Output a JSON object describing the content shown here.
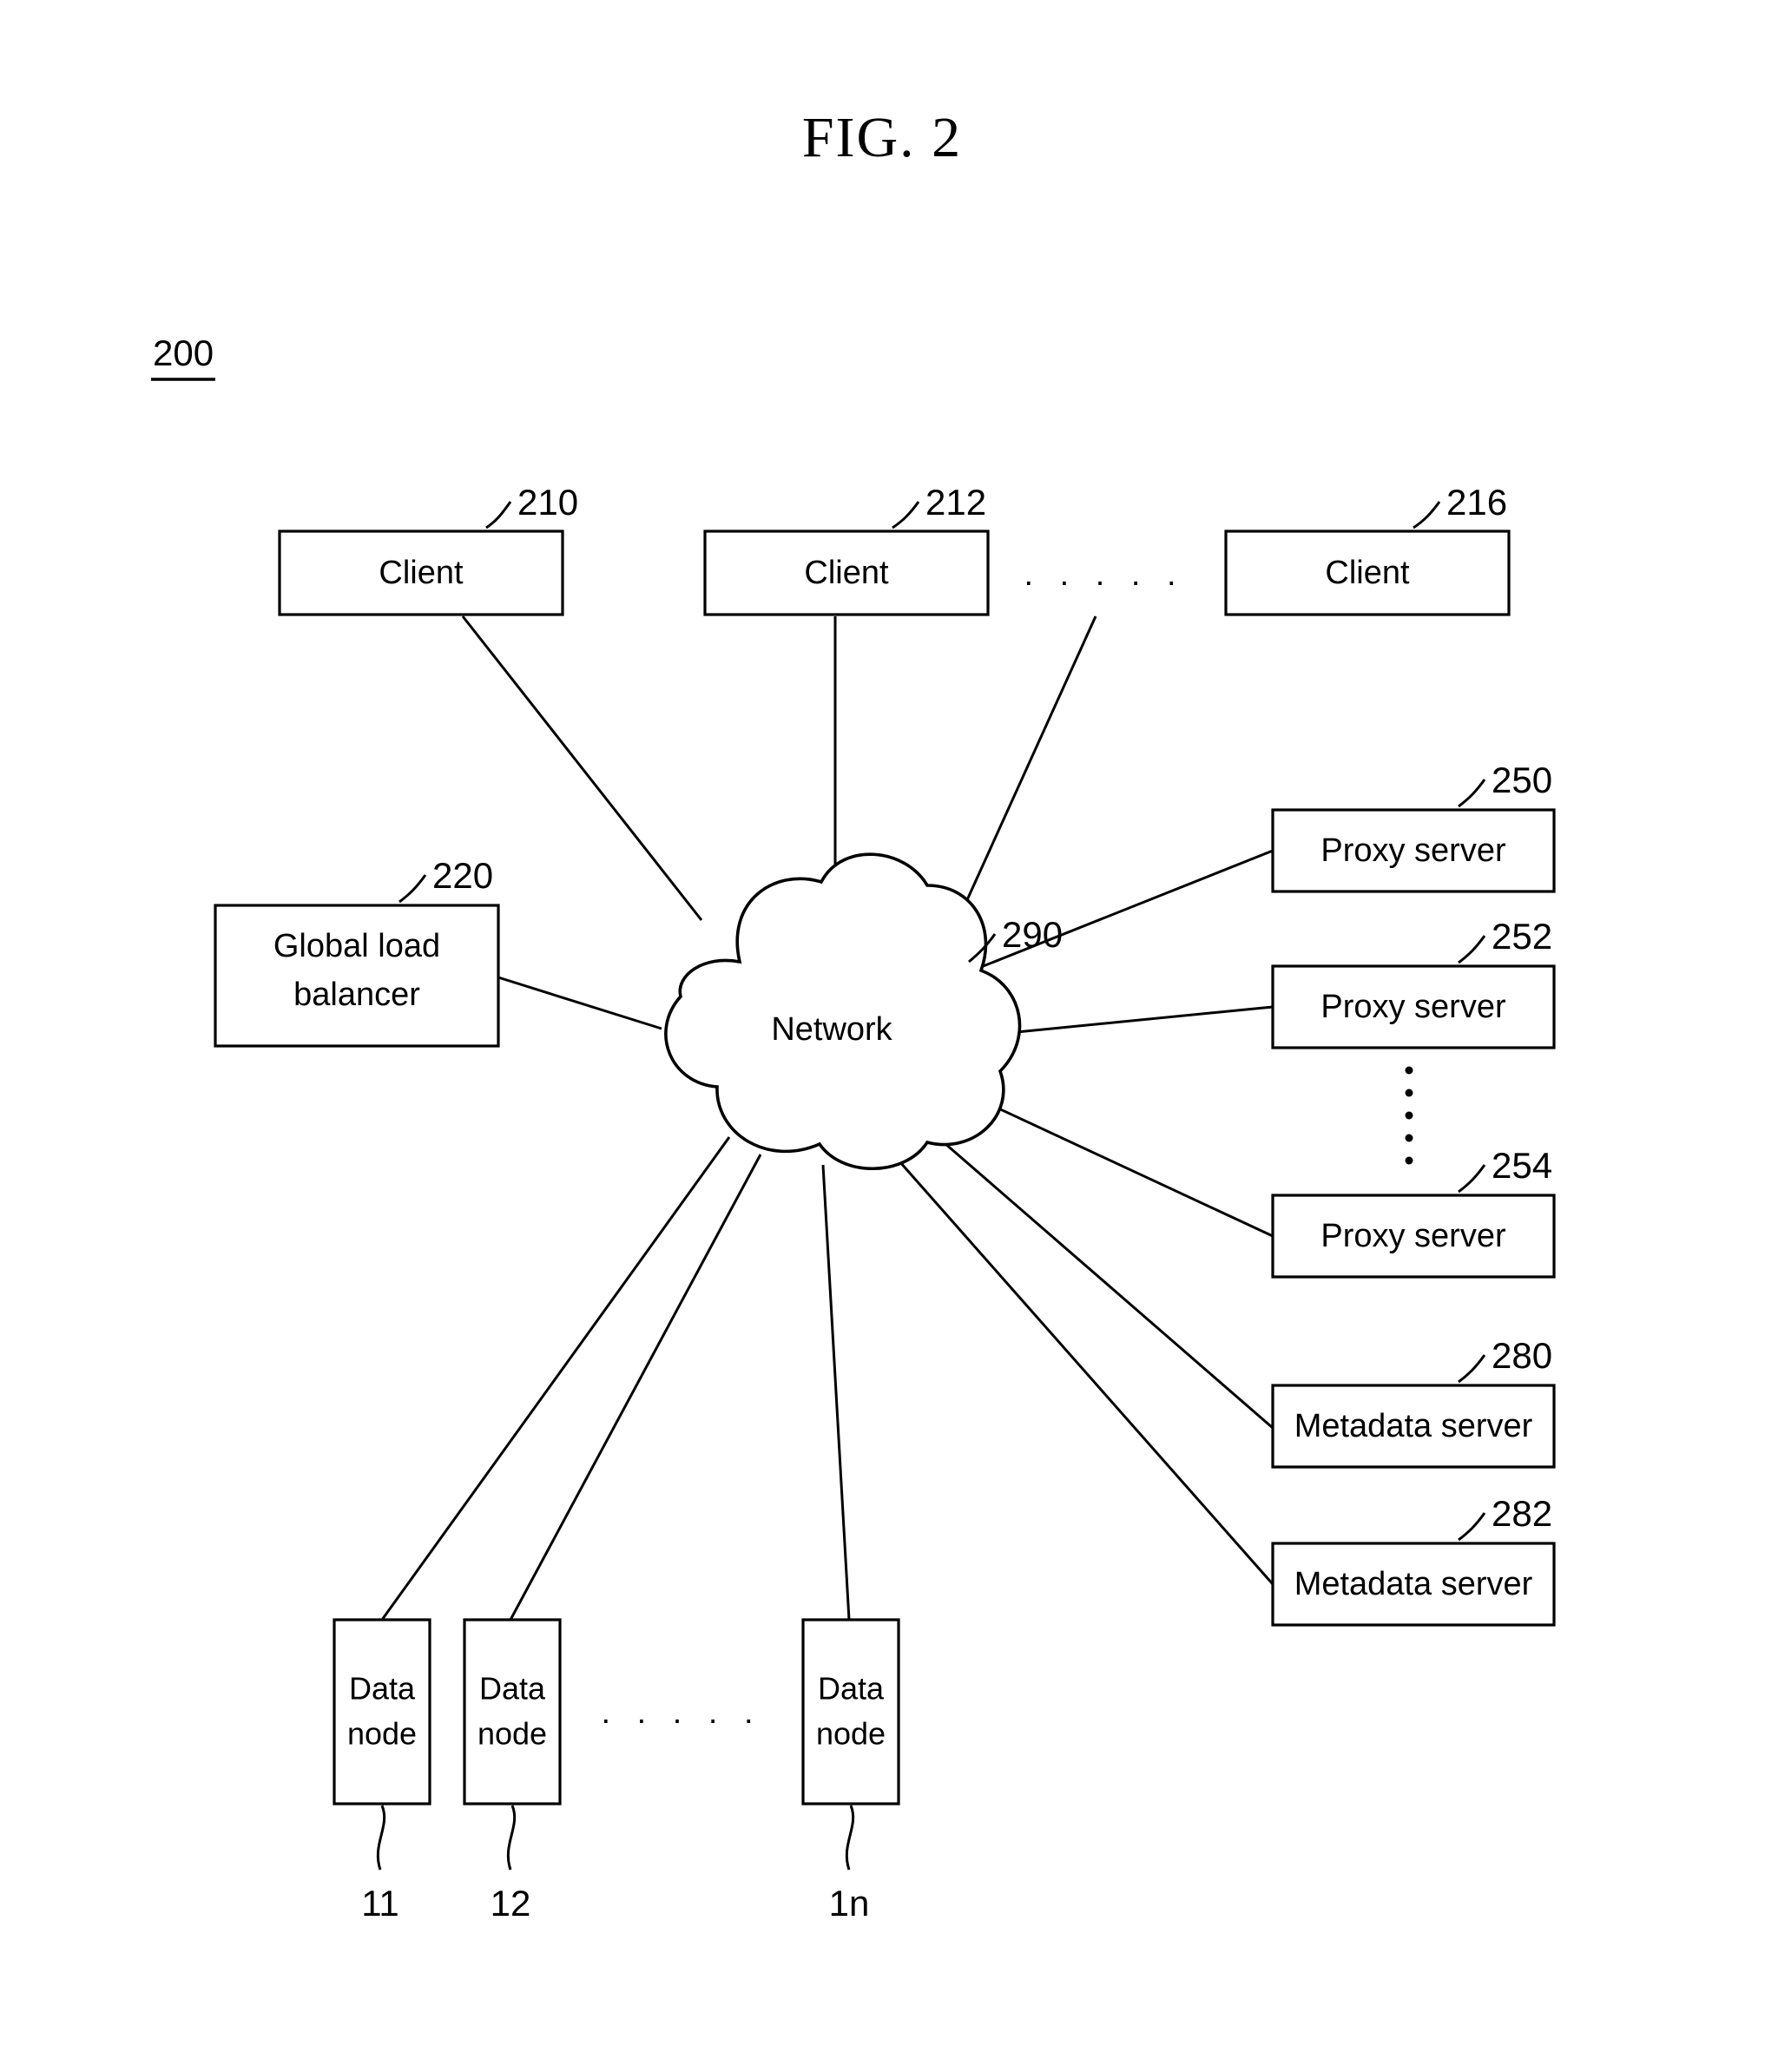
{
  "figure": {
    "title": "FIG. 2",
    "system_ref": "200"
  },
  "clients": [
    {
      "label": "Client",
      "ref": "210"
    },
    {
      "label": "Client",
      "ref": "212"
    },
    {
      "label": "Client",
      "ref": "216"
    }
  ],
  "client_ellipsis": ". . . . .",
  "load_balancer": {
    "label_line1": "Global load",
    "label_line2": "balancer",
    "ref": "220"
  },
  "network": {
    "label": "Network",
    "ref": "290"
  },
  "proxy_servers": [
    {
      "label": "Proxy server",
      "ref": "250"
    },
    {
      "label": "Proxy server",
      "ref": "252"
    },
    {
      "label": "Proxy server",
      "ref": "254"
    }
  ],
  "proxy_ellipsis": ":",
  "metadata_servers": [
    {
      "label": "Metadata server",
      "ref": "280"
    },
    {
      "label": "Metadata server",
      "ref": "282"
    }
  ],
  "data_nodes": [
    {
      "label_line1": "Data",
      "label_line2": "node",
      "number": "11"
    },
    {
      "label_line1": "Data",
      "label_line2": "node",
      "number": "12"
    },
    {
      "label_line1": "Data",
      "label_line2": "node",
      "number": "1n"
    }
  ],
  "data_node_ellipsis": ". . . . .",
  "colors": {
    "ink": "#000000",
    "paper": "#ffffff"
  }
}
